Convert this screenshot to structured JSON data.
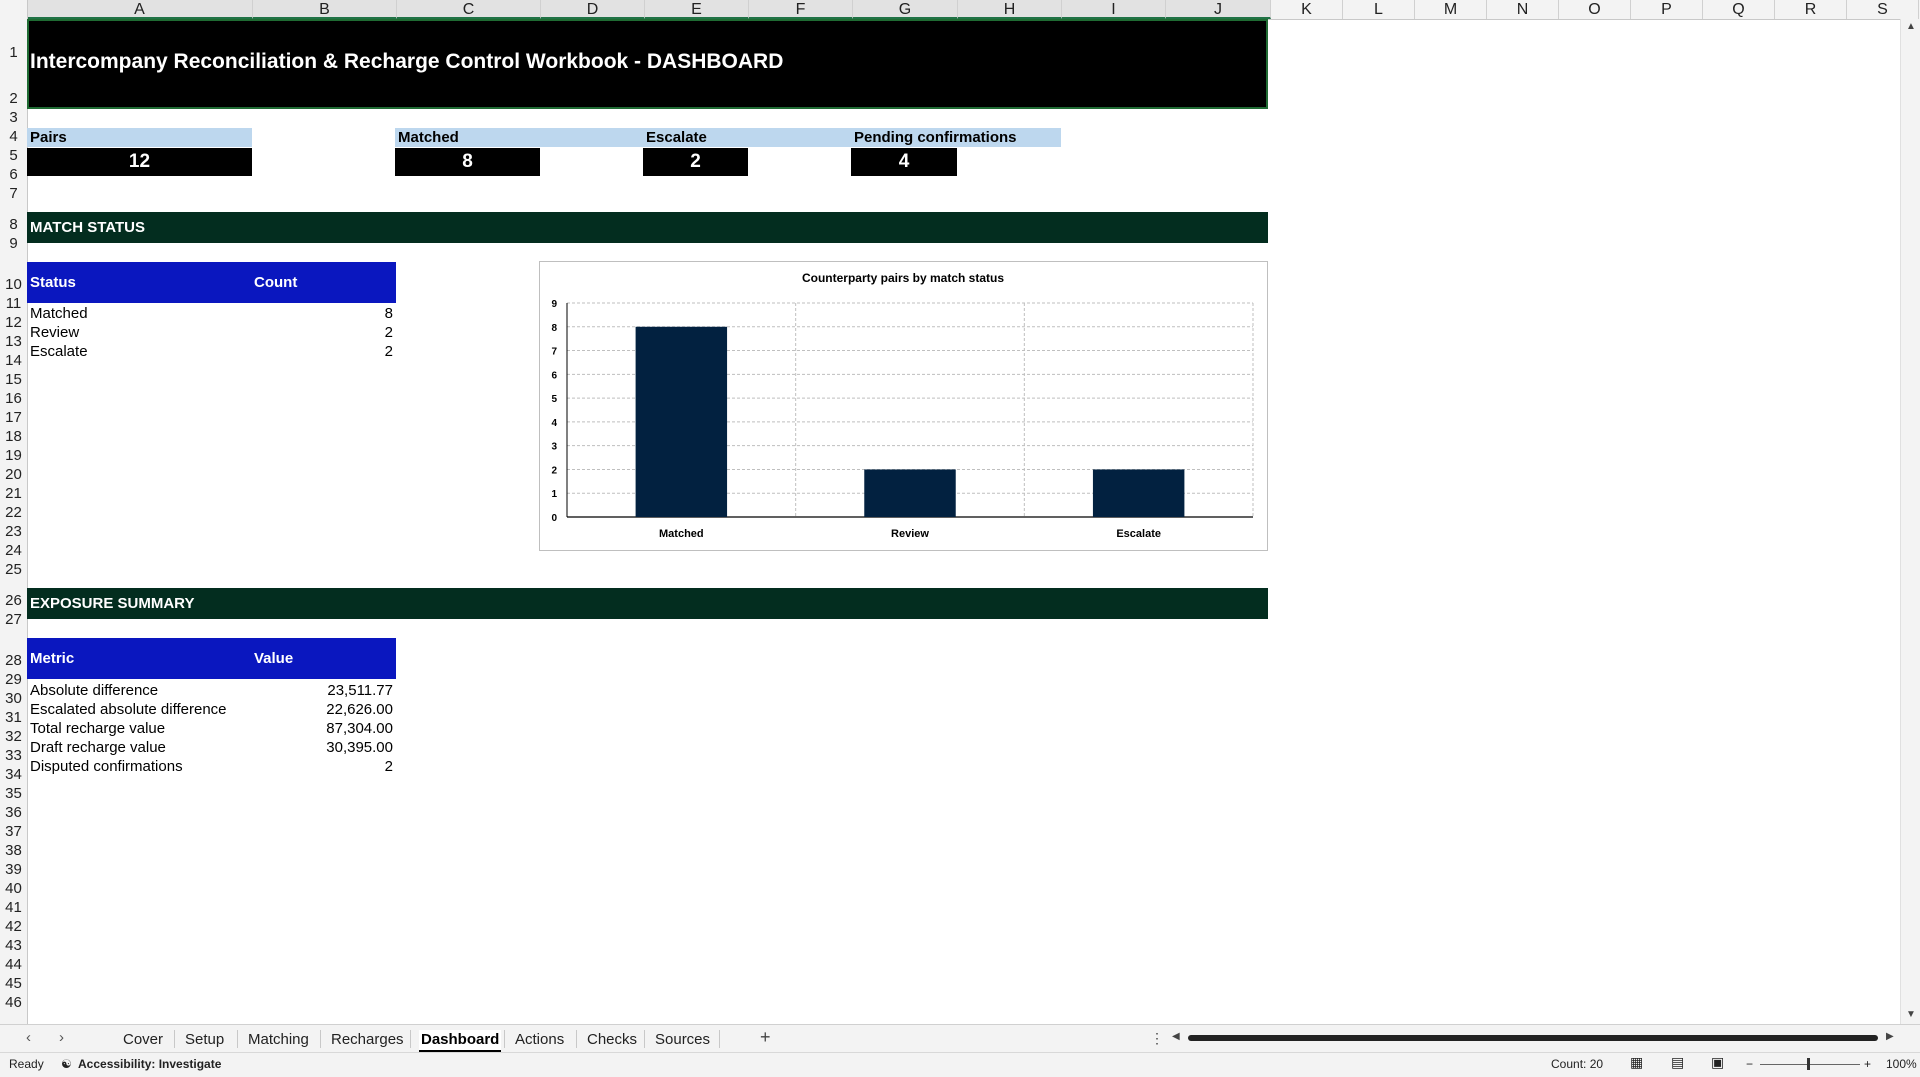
{
  "columns": [
    "A",
    "B",
    "C",
    "D",
    "E",
    "F",
    "G",
    "H",
    "I",
    "J",
    "K",
    "L",
    "M",
    "N",
    "O",
    "P",
    "Q",
    "R",
    "S"
  ],
  "rows": [
    "1",
    "2",
    "3",
    "4",
    "5",
    "6",
    "7",
    "8",
    "9",
    "10",
    "11",
    "12",
    "13",
    "14",
    "15",
    "16",
    "17",
    "18",
    "19",
    "20",
    "21",
    "22",
    "23",
    "24",
    "25",
    "26",
    "27",
    "28",
    "29",
    "30",
    "31",
    "32",
    "33",
    "34",
    "35",
    "36",
    "37",
    "38",
    "39",
    "40",
    "41",
    "42",
    "43",
    "44",
    "45",
    "46"
  ],
  "title": "Intercompany Reconciliation & Recharge Control Workbook - DASHBOARD",
  "kpis": [
    {
      "label": "Pairs",
      "value": "12"
    },
    {
      "label": "Matched",
      "value": "8"
    },
    {
      "label": "Escalate",
      "value": "2"
    },
    {
      "label": "Pending confirmations",
      "value": "4"
    }
  ],
  "sections": {
    "match_status": "MATCH STATUS",
    "exposure_summary": "EXPOSURE SUMMARY"
  },
  "status_table": {
    "headers": [
      "Status",
      "Count"
    ],
    "rows": [
      {
        "label": "Matched",
        "value": "8"
      },
      {
        "label": "Review",
        "value": "2"
      },
      {
        "label": "Escalate",
        "value": "2"
      }
    ]
  },
  "exposure_table": {
    "headers": [
      "Metric",
      "Value"
    ],
    "rows": [
      {
        "label": "Absolute difference",
        "value": "23,511.77"
      },
      {
        "label": "Escalated absolute difference",
        "value": "22,626.00"
      },
      {
        "label": "Total recharge value",
        "value": "87,304.00"
      },
      {
        "label": "Draft recharge value",
        "value": "30,395.00"
      },
      {
        "label": "Disputed confirmations",
        "value": "2"
      }
    ]
  },
  "chart_data": {
    "type": "bar",
    "title": "Counterparty pairs by match status",
    "categories": [
      "Matched",
      "Review",
      "Escalate"
    ],
    "values": [
      8,
      2,
      2
    ],
    "ylim": [
      0,
      9
    ],
    "yticks": [
      "0",
      "1",
      "2",
      "3",
      "4",
      "5",
      "6",
      "7",
      "8",
      "9"
    ],
    "grid": true,
    "bar_color": "#022140"
  },
  "tabs": [
    "Cover",
    "Setup",
    "Matching",
    "Recharges",
    "Dashboard",
    "Actions",
    "Checks",
    "Sources"
  ],
  "active_tab": "Dashboard",
  "status": {
    "ready": "Ready",
    "accessibility": "Accessibility: Investigate",
    "count": "Count: 20",
    "zoom": "100%"
  },
  "colors": {
    "title_bg": "#000000",
    "kpi_label_bg": "#bdd7ee",
    "section_band": "#032d1f",
    "table_header": "#0a17bf"
  }
}
